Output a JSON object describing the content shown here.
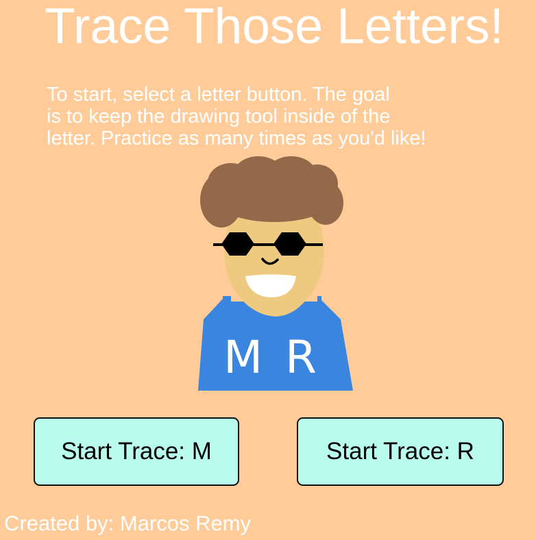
{
  "title": "Trace Those Letters!",
  "instructions": {
    "line1": "To start, select a letter button. The goal",
    "line2": "is to keep the drawing tool inside of the",
    "line3": "letter. Practice as many times as you'd like!"
  },
  "avatar": {
    "shirt_text": "M R"
  },
  "buttons": {
    "trace_m": "Start Trace: M",
    "trace_r": "Start Trace: R"
  },
  "credit": "Created by: Marcos Remy",
  "colors": {
    "background": "#FFCC99",
    "button_fill": "#B9FCEE",
    "shirt": "#3A85E0",
    "hair": "#93694A",
    "skin": "#EDCA80"
  }
}
